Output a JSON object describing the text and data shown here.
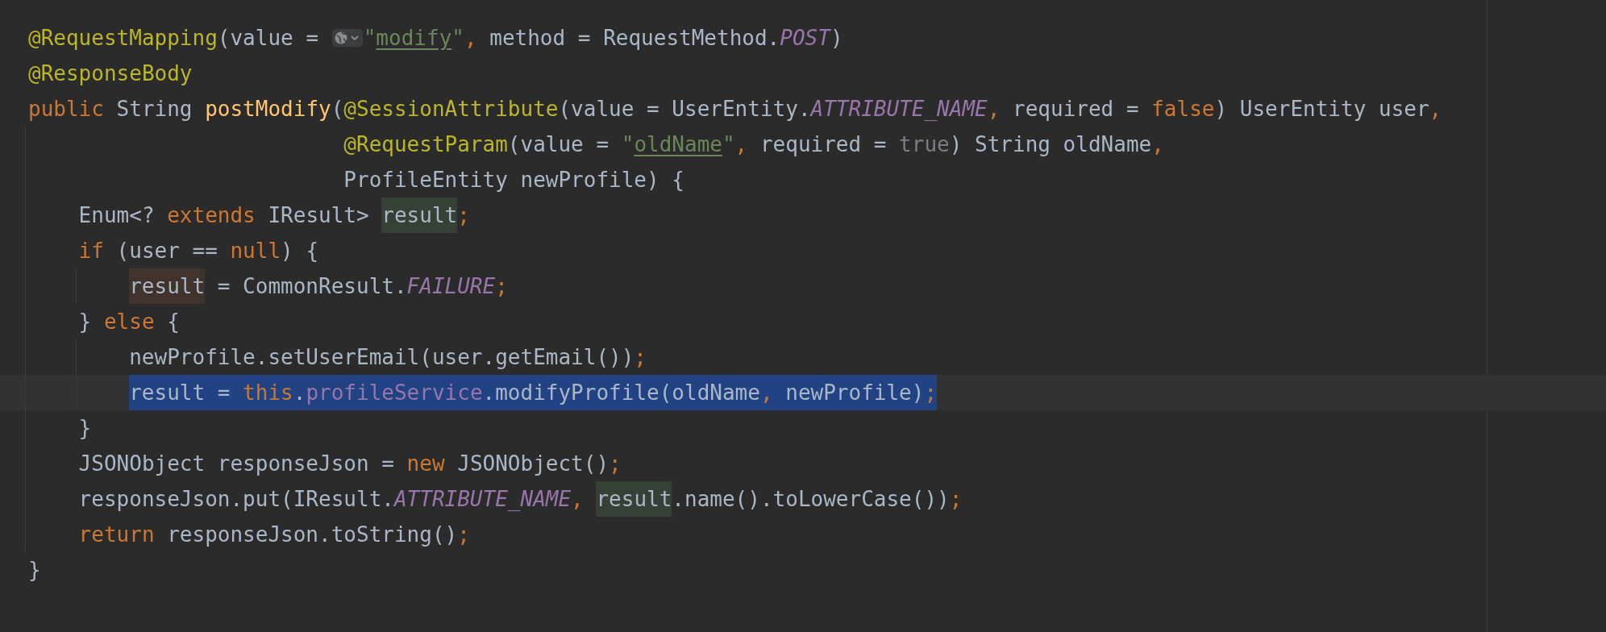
{
  "editor": {
    "lines": [
      {
        "selected": false,
        "kind": "top",
        "tokens": [
          {
            "kind": "annotation",
            "text": "@RequestMapping"
          },
          {
            "kind": "plain",
            "text": "(value = "
          },
          {
            "kind": "hint"
          },
          {
            "kind": "string",
            "text": "\""
          },
          {
            "kind": "link",
            "text": "modify"
          },
          {
            "kind": "string",
            "text": "\""
          },
          {
            "kind": "punct",
            "text": ","
          },
          {
            "kind": "plain",
            "text": " method = RequestMethod."
          },
          {
            "kind": "field",
            "text": "POST"
          },
          {
            "kind": "plain",
            "text": ")"
          }
        ]
      },
      {
        "selected": false,
        "kind": "top",
        "tokens": [
          {
            "kind": "annotation",
            "text": "@ResponseBody"
          }
        ]
      },
      {
        "selected": false,
        "kind": "top",
        "tokens": [
          {
            "kind": "keyword",
            "text": "public"
          },
          {
            "kind": "plain",
            "text": " String "
          },
          {
            "kind": "method",
            "text": "postModify"
          },
          {
            "kind": "plain",
            "text": "("
          },
          {
            "kind": "annotation",
            "text": "@SessionAttribute"
          },
          {
            "kind": "plain",
            "text": "(value = UserEntity."
          },
          {
            "kind": "field",
            "text": "ATTRIBUTE_NAME"
          },
          {
            "kind": "punct",
            "text": ","
          },
          {
            "kind": "plain",
            "text": " required = "
          },
          {
            "kind": "keyword",
            "text": "false"
          },
          {
            "kind": "plain",
            "text": ") UserEntity user"
          },
          {
            "kind": "punct",
            "text": ","
          }
        ]
      },
      {
        "selected": false,
        "kind": "continuation",
        "tokens": [
          {
            "kind": "annotation",
            "text": "@RequestParam"
          },
          {
            "kind": "plain",
            "text": "(value = "
          },
          {
            "kind": "string",
            "text": "\""
          },
          {
            "kind": "link",
            "text": "oldName"
          },
          {
            "kind": "string",
            "text": "\""
          },
          {
            "kind": "punct",
            "text": ","
          },
          {
            "kind": "plain",
            "text": " required = "
          },
          {
            "kind": "dim",
            "text": "true"
          },
          {
            "kind": "plain",
            "text": ") String oldName"
          },
          {
            "kind": "punct",
            "text": ","
          }
        ]
      },
      {
        "selected": false,
        "kind": "continuation",
        "tokens": [
          {
            "kind": "plain",
            "text": "ProfileEntity newProfile) {"
          }
        ]
      },
      {
        "selected": false,
        "kind": "body",
        "tokens": [
          {
            "kind": "plain",
            "text": "Enum<? "
          },
          {
            "kind": "keyword",
            "text": "extends"
          },
          {
            "kind": "plain",
            "text": " IResult> "
          },
          {
            "kind": "usage_read",
            "text": "result"
          },
          {
            "kind": "punct",
            "text": ";"
          }
        ]
      },
      {
        "selected": false,
        "kind": "body",
        "tokens": [
          {
            "kind": "keyword",
            "text": "if"
          },
          {
            "kind": "plain",
            "text": " (user == "
          },
          {
            "kind": "keyword",
            "text": "null"
          },
          {
            "kind": "plain",
            "text": ") {"
          }
        ]
      },
      {
        "selected": false,
        "kind": "inner",
        "tokens": [
          {
            "kind": "usage_write",
            "text": "result"
          },
          {
            "kind": "plain",
            "text": " = CommonResult."
          },
          {
            "kind": "field",
            "text": "FAILURE"
          },
          {
            "kind": "punct",
            "text": ";"
          }
        ]
      },
      {
        "selected": false,
        "kind": "body",
        "tokens": [
          {
            "kind": "plain",
            "text": "} "
          },
          {
            "kind": "keyword",
            "text": "else"
          },
          {
            "kind": "plain",
            "text": " {"
          }
        ]
      },
      {
        "selected": false,
        "kind": "inner",
        "tokens": [
          {
            "kind": "plain",
            "text": "newProfile.setUserEmail(user.getEmail())"
          },
          {
            "kind": "punct",
            "text": ";"
          }
        ]
      },
      {
        "selected": true,
        "kind": "inner",
        "tokens": [
          {
            "kind": "plain",
            "text": "result = "
          },
          {
            "kind": "keyword",
            "text": "this"
          },
          {
            "kind": "plain",
            "text": "."
          },
          {
            "kind": "member",
            "text": "profileService"
          },
          {
            "kind": "plain",
            "text": ".modifyProfile(oldName"
          },
          {
            "kind": "punct",
            "text": ","
          },
          {
            "kind": "plain",
            "text": " newProfile)"
          },
          {
            "kind": "punct",
            "text": ";"
          }
        ]
      },
      {
        "selected": false,
        "kind": "body",
        "tokens": [
          {
            "kind": "plain",
            "text": "}"
          }
        ]
      },
      {
        "selected": false,
        "kind": "body",
        "tokens": [
          {
            "kind": "plain",
            "text": "JSONObject responseJson = "
          },
          {
            "kind": "keyword",
            "text": "new"
          },
          {
            "kind": "plain",
            "text": " JSONObject()"
          },
          {
            "kind": "punct",
            "text": ";"
          }
        ]
      },
      {
        "selected": false,
        "kind": "body",
        "tokens": [
          {
            "kind": "plain",
            "text": "responseJson.put(IResult."
          },
          {
            "kind": "field",
            "text": "ATTRIBUTE_NAME"
          },
          {
            "kind": "punct",
            "text": ", "
          },
          {
            "kind": "usage_read",
            "text": "result"
          },
          {
            "kind": "plain",
            "text": ".name().toLowerCase())"
          },
          {
            "kind": "punct",
            "text": ";"
          }
        ]
      },
      {
        "selected": false,
        "kind": "body",
        "tokens": [
          {
            "kind": "keyword",
            "text": "return"
          },
          {
            "kind": "plain",
            "text": " responseJson.toString()"
          },
          {
            "kind": "punct",
            "text": ";"
          }
        ]
      },
      {
        "selected": false,
        "kind": "top",
        "tokens": [
          {
            "kind": "plain",
            "text": "}"
          }
        ]
      }
    ]
  }
}
